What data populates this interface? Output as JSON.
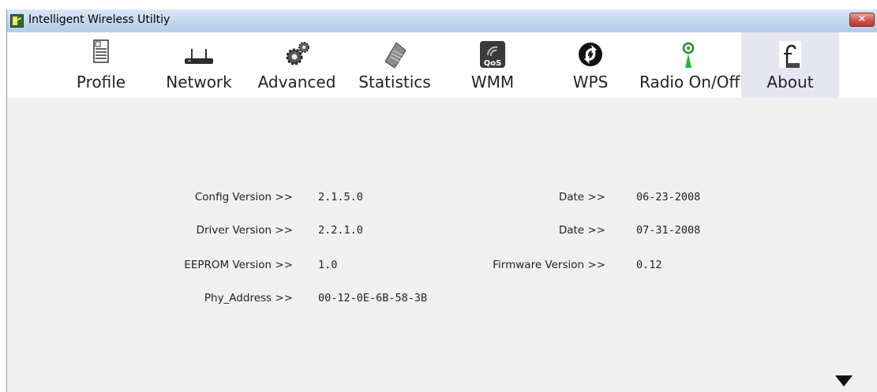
{
  "window": {
    "title": "Intelligent Wireless Utiltiy",
    "close_label": "✕"
  },
  "toolbar": {
    "items": [
      {
        "label": "Profile",
        "icon": "profile-icon"
      },
      {
        "label": "Network",
        "icon": "network-icon"
      },
      {
        "label": "Advanced",
        "icon": "advanced-icon"
      },
      {
        "label": "Statistics",
        "icon": "statistics-icon"
      },
      {
        "label": "WMM",
        "icon": "wmm-qos-icon",
        "badge": "QoS"
      },
      {
        "label": "WPS",
        "icon": "wps-icon"
      },
      {
        "label": "Radio On/Off",
        "icon": "radio-icon"
      },
      {
        "label": "About",
        "icon": "about-icon",
        "active": true
      }
    ]
  },
  "about": {
    "config_version_label": "Config Version >>",
    "config_version": "2.1.5.0",
    "config_date_label": "Date >>",
    "config_date": "06-23-2008",
    "driver_version_label": "Driver Version >>",
    "driver_version": "2.2.1.0",
    "driver_date_label": "Date >>",
    "driver_date": "07-31-2008",
    "eeprom_version_label": "EEPROM Version >>",
    "eeprom_version": "1.0",
    "firmware_version_label": "Firmware Version >>",
    "firmware_version": "0.12",
    "phy_address_label": "Phy_Address >>",
    "phy_address": "00-12-0E-6B-58-3B"
  },
  "colors": {
    "active_tab_bg": "#e6e6f3",
    "window_bg": "#f0f0f0",
    "titlebar": "#c3d6ee"
  }
}
